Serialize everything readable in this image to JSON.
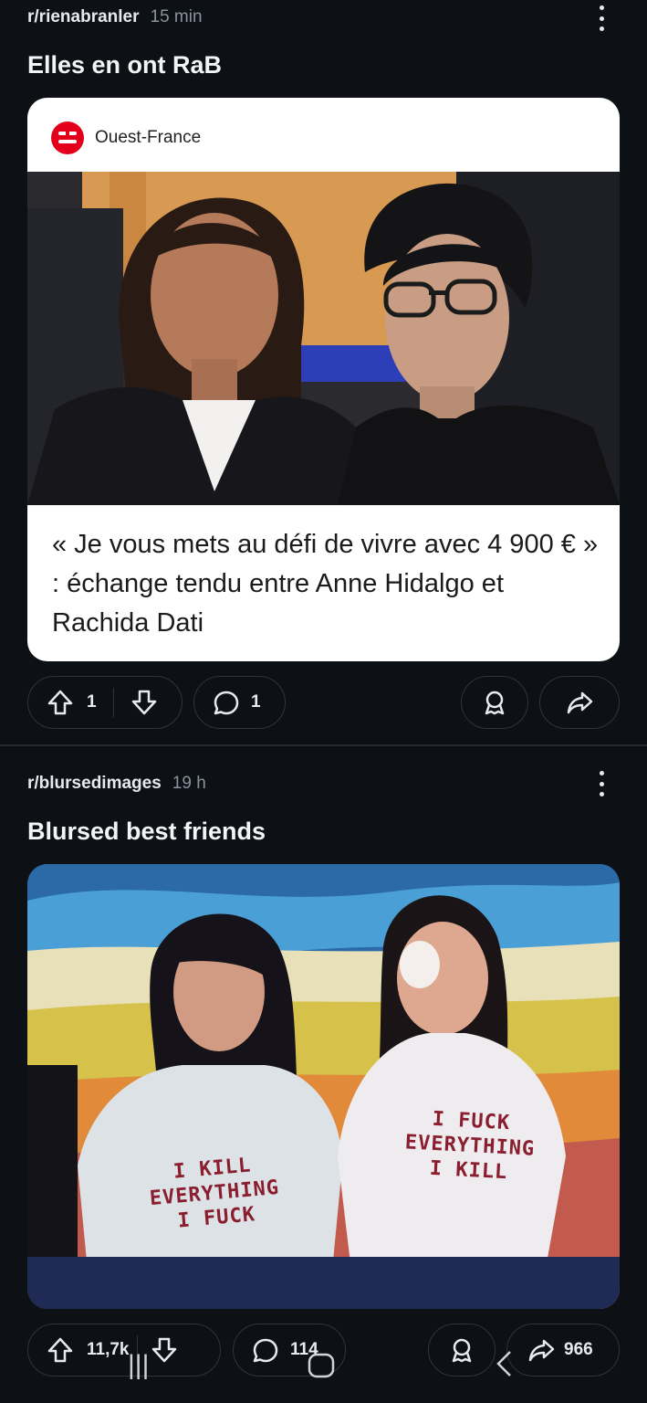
{
  "posts": [
    {
      "subreddit": "r/rienabranler",
      "time": "15 min",
      "title": "Elles en ont RaB",
      "link_card": {
        "source": "Ouest-France",
        "headline": "« Je vous mets au défi de vivre avec 4 900 € » : échange tendu entre Anne Hidalgo et Rachida Dati"
      },
      "upvotes": "1",
      "comments": "1",
      "share": ""
    },
    {
      "subreddit": "r/blursedimages",
      "time": "19 h",
      "title": "Blursed best friends",
      "shirt_left": "I KILL\nEVERYTHING\nI FUCK",
      "shirt_right": "I FUCK\nEVERYTHING\nI KILL",
      "upvotes": "11,7k",
      "comments": "114",
      "share": "966"
    }
  ],
  "colors": {
    "background": "#0d1014",
    "pill_border": "#2f353d",
    "brand_red": "#e2001a"
  },
  "icons": [
    "more-vertical-icon",
    "upvote-icon",
    "downvote-icon",
    "comment-icon",
    "award-icon",
    "share-icon"
  ]
}
